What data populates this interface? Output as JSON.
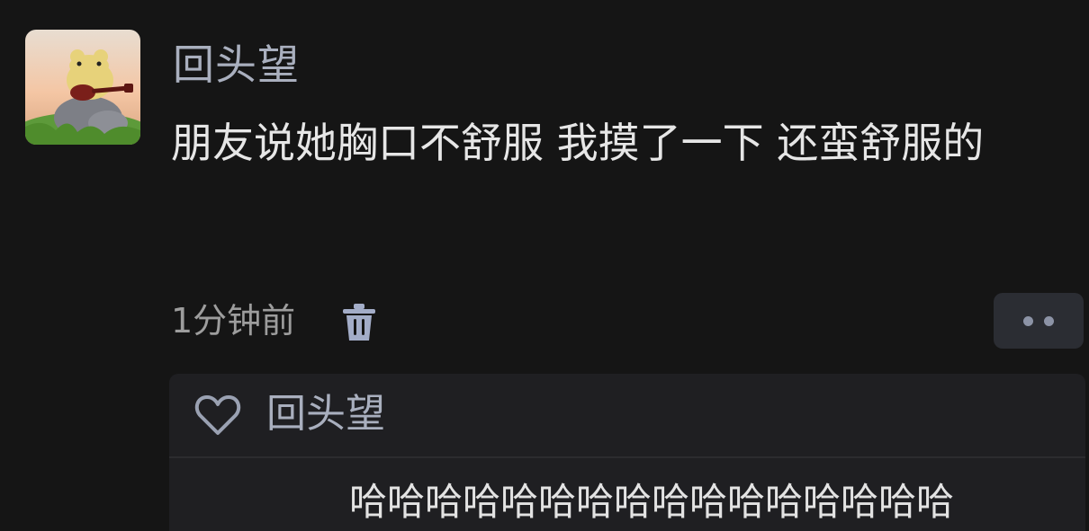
{
  "post": {
    "username": "回头望",
    "text": "朋友说她胸口不舒服 我摸了一下 还蛮舒服的",
    "time": "1分钟前",
    "delete_icon": "trash-icon",
    "more_icon": "more-dots-icon"
  },
  "likes": {
    "icon": "heart-icon",
    "user": "回头望"
  },
  "reply": {
    "text": "哈哈哈哈哈哈哈哈哈哈哈哈哈哈哈哈"
  },
  "colors": {
    "background": "#151515",
    "username": "#a9afbe",
    "text": "#e6e6e6",
    "secondary": "#9d9d9d",
    "icon": "#a3adc8",
    "panel": "#1f1f22"
  }
}
